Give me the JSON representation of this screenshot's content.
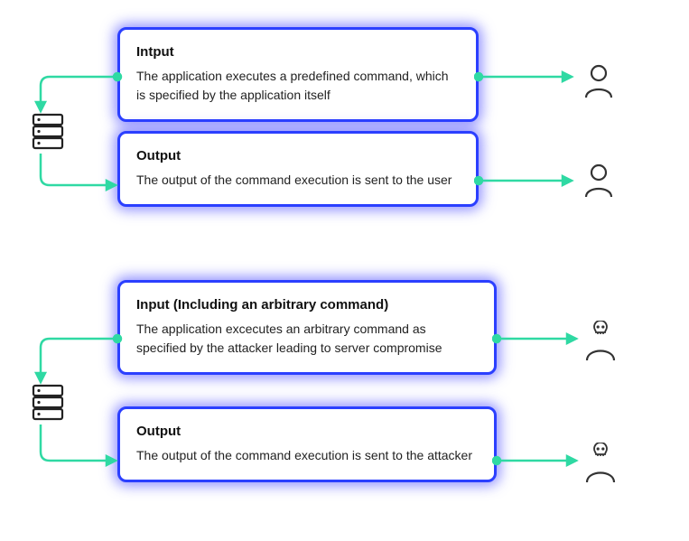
{
  "scenario_normal": {
    "input": {
      "title": "Intput",
      "body": "The application executes a predefined command, which is specified by the application itself"
    },
    "output": {
      "title": "Output",
      "body": "The output of the command execution is sent to the user"
    },
    "actor": "user"
  },
  "scenario_attack": {
    "input": {
      "title": "Input (Including an arbitrary command)",
      "body": "The application excecutes an arbitrary command as specified by the attacker leading to server compromise"
    },
    "output": {
      "title": "Output",
      "body": "The output of the command execution is sent to the attacker"
    },
    "actor": "attacker"
  }
}
